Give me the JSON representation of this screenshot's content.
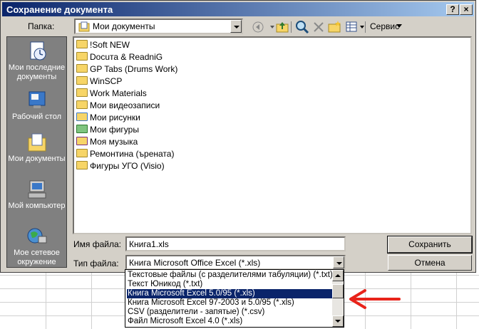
{
  "dialog": {
    "title": "Сохранение документа",
    "title_buttons": {
      "help": "?",
      "close": "×"
    }
  },
  "toolbar": {
    "folder_label": "Папка:",
    "folder_value": "Мои документы",
    "tools_label": "Сервис"
  },
  "places": [
    {
      "label": "Мои последние документы",
      "icon": "recent-docs-icon"
    },
    {
      "label": "Рабочий стол",
      "icon": "desktop-icon"
    },
    {
      "label": "Мои документы",
      "icon": "my-documents-icon"
    },
    {
      "label": "Мой компьютер",
      "icon": "my-computer-icon"
    },
    {
      "label": "Мое сетевое окружение",
      "icon": "network-icon"
    }
  ],
  "files": [
    {
      "name": "!Soft NEW",
      "icon": "folder-icon"
    },
    {
      "name": "Docuта & ReadniG",
      "icon": "folder-icon"
    },
    {
      "name": "GP Tabs (Drums Work)",
      "icon": "folder-icon"
    },
    {
      "name": "WinSCP",
      "icon": "folder-icon"
    },
    {
      "name": "Work Materials",
      "icon": "folder-icon"
    },
    {
      "name": "Мои видеозаписи",
      "icon": "folder-icon"
    },
    {
      "name": "Мои рисунки",
      "icon": "pictures-folder-icon"
    },
    {
      "name": "Мои фигуры",
      "icon": "shapes-folder-icon"
    },
    {
      "name": "Моя музыка",
      "icon": "music-folder-icon"
    },
    {
      "name": "Ремонтина (ърената)",
      "icon": "folder-icon"
    },
    {
      "name": "Фигуры УГО (Visio)",
      "icon": "folder-icon"
    }
  ],
  "form": {
    "filename_label": "Имя файла:",
    "filename_value": "Книга1.xls",
    "filetype_label": "Тип файла:",
    "filetype_value": "Книга Microsoft Office Excel (*.xls)",
    "save_button": "Сохранить",
    "cancel_button": "Отмена"
  },
  "filetype_options": [
    "Текстовые файлы (с разделителями табуляции) (*.txt)",
    "Текст Юникод (*.txt)",
    "Книга Microsoft Excel 5.0/95 (*.xls)",
    "Книга Microsoft Excel 97-2003 и 5.0/95 (*.xls)",
    "CSV (разделители - запятые) (*.csv)",
    "Файл Microsoft Excel 4.0 (*.xls)"
  ],
  "selected_option_index": 2,
  "colors": {
    "title_start": "#0a246a",
    "title_end": "#a6caf0",
    "selection": "#0a246a",
    "arrow": "#e8231a"
  }
}
